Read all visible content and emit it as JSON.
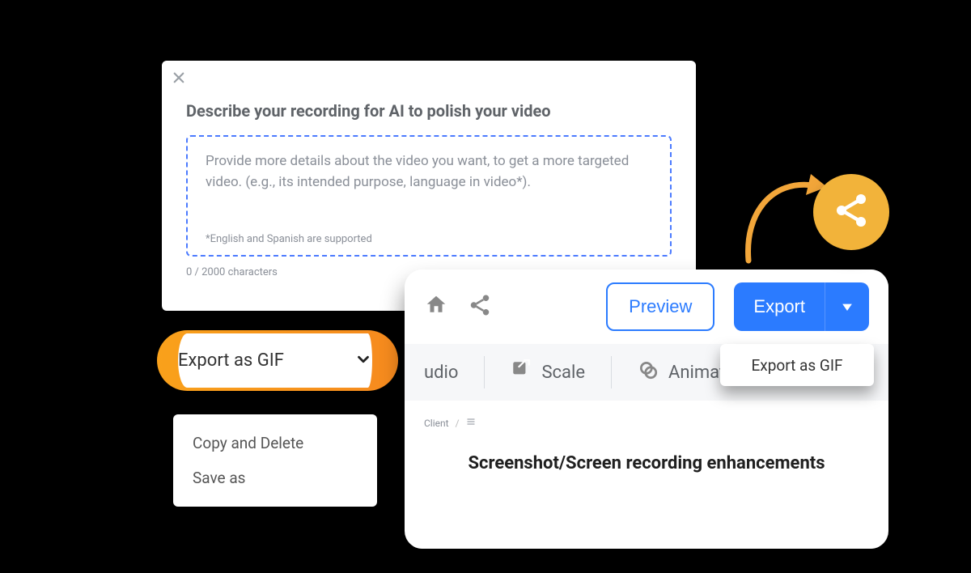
{
  "ai_panel": {
    "title": "Describe your recording for AI to polish your video",
    "placeholder": "Provide more details about the video you want, to get a more targeted video. (e.g., its intended purpose, language in video*).",
    "footnote": "*English and Spanish are supported",
    "counter": "0 / 2000 characters"
  },
  "gif_pill": {
    "label": "Export as GIF"
  },
  "context_menu": {
    "items": [
      "Copy and Delete",
      "Save as"
    ]
  },
  "editor": {
    "preview_label": "Preview",
    "export_label": "Export",
    "tools": [
      "udio",
      "Scale",
      "Animation"
    ],
    "breadcrumb": [
      "Client"
    ],
    "doc_title": "Screenshot/Screen recording enhancements"
  },
  "export_dropdown": {
    "label": "Export as GIF"
  },
  "icons": {
    "close": "close",
    "chevron_down": "chevron-down",
    "home": "home",
    "share_small": "share",
    "share_big": "share",
    "scale": "scale",
    "animation": "animation",
    "caret_down": "caret-down",
    "hamburger": "hamburger"
  }
}
